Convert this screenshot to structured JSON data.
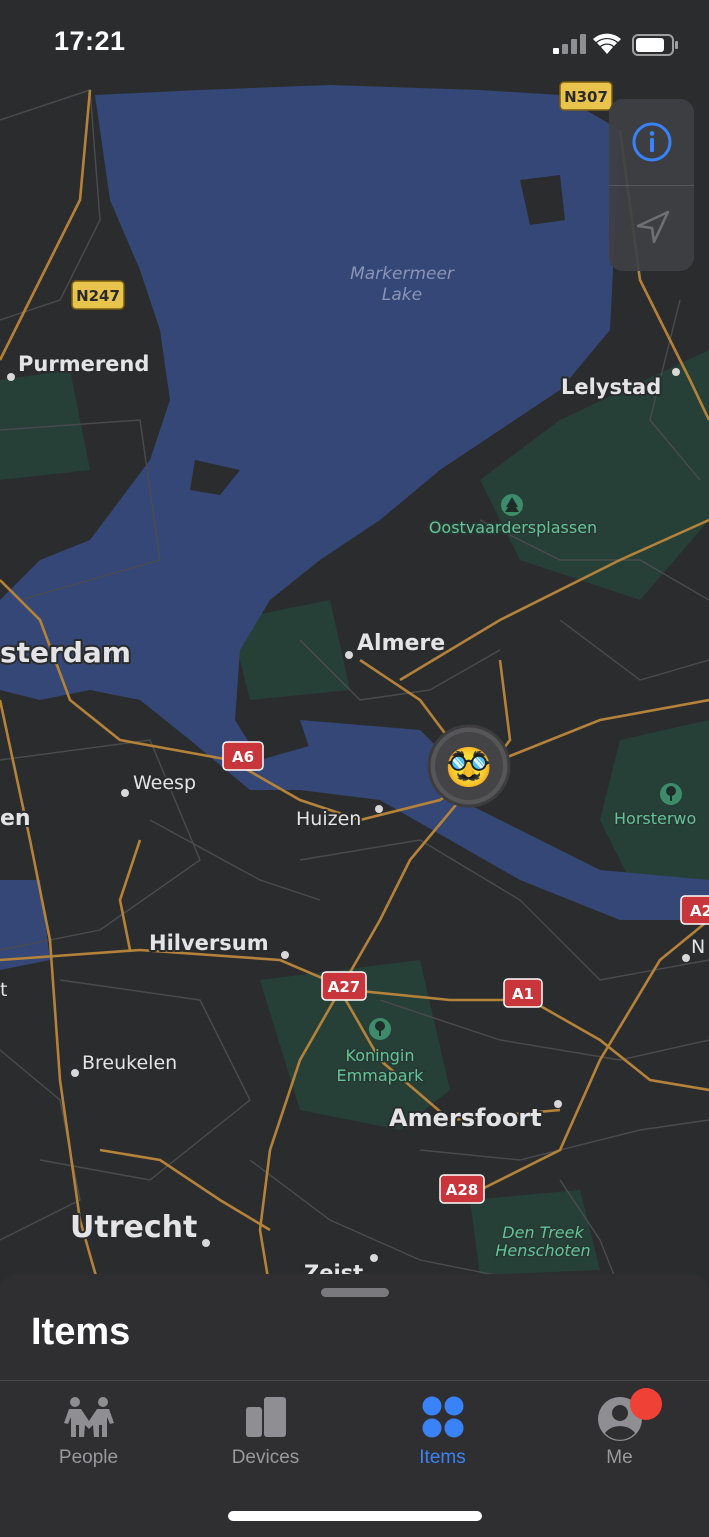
{
  "status_bar": {
    "time": "17:21"
  },
  "map": {
    "water": [
      {
        "name": "Markermeer",
        "sub": "Lake"
      }
    ],
    "places": [
      {
        "name": "Purmerend"
      },
      {
        "name": "Lelystad"
      },
      {
        "name": "sterdam"
      },
      {
        "name": "Almere"
      },
      {
        "name": "Weesp"
      },
      {
        "name": "Huizen"
      },
      {
        "name": "en"
      },
      {
        "name": "Hilversum"
      },
      {
        "name": "Breukelen"
      },
      {
        "name": "Amersfoort"
      },
      {
        "name": "Utrecht"
      },
      {
        "name": "Zeist"
      },
      {
        "name": "N"
      },
      {
        "name": "t"
      }
    ],
    "parks": [
      {
        "name": "Oostvaardersplassen"
      },
      {
        "name": "Horsterwo"
      },
      {
        "name": "Koningin",
        "sub": "Emmapark"
      },
      {
        "name": "Den Treek",
        "sub": "Henschoten"
      }
    ],
    "road_signs": [
      {
        "label": "N307"
      },
      {
        "label": "N247"
      },
      {
        "label": "A6"
      },
      {
        "label": "A27"
      },
      {
        "label": "A1"
      },
      {
        "label": "A28"
      },
      {
        "label": "A2"
      }
    ],
    "marker_emoji": "🥸"
  },
  "controls": {
    "info_icon": "info-icon",
    "location_icon": "location-arrow-icon"
  },
  "sheet": {
    "title": "Items"
  },
  "tabs": [
    {
      "label": "People",
      "icon": "people-icon",
      "active": false
    },
    {
      "label": "Devices",
      "icon": "devices-icon",
      "active": false
    },
    {
      "label": "Items",
      "icon": "items-icon",
      "active": true
    },
    {
      "label": "Me",
      "icon": "me-icon",
      "active": false,
      "badge": true
    }
  ],
  "colors": {
    "accent": "#3a82f7",
    "badge": "#ef4136",
    "water": "#344776",
    "land": "#2b2c2e",
    "road": "#b5823a"
  }
}
